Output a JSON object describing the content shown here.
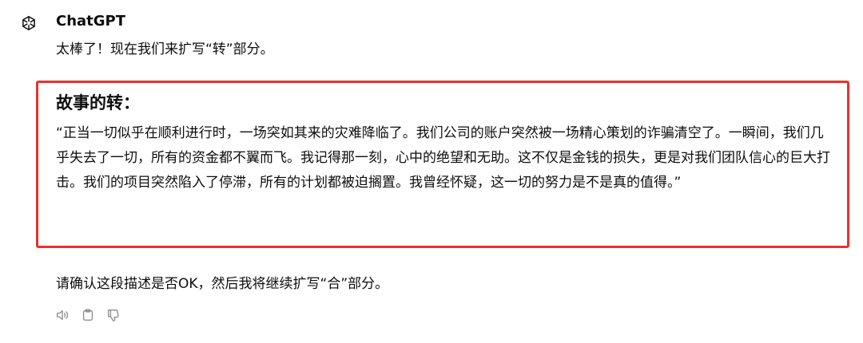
{
  "message": {
    "author": "ChatGPT",
    "intro": "太棒了！现在我们来扩写“转”部分。",
    "section_title": "故事的转：",
    "story": "“正当一切似乎在顺利进行时，一场突如其来的灾难降临了。我们公司的账户突然被一场精心策划的诈骗清空了。一瞬间，我们几乎失去了一切，所有的资金都不翼而飞。我记得那一刻，心中的绝望和无助。这不仅是金钱的损失，更是对我们团队信心的巨大打击。我们的项目突然陷入了停滞，所有的计划都被迫搁置。我曾经怀疑，这一切的努力是不是真的值得。”",
    "confirm": "请确认这段描述是否OK，然后我将继续扩写“合”部分。"
  },
  "colors": {
    "highlight_border": "#e8322b",
    "text": "#0d0d0d",
    "icon": "#8e8e8e"
  },
  "actions": [
    {
      "icon": "speaker-icon"
    },
    {
      "icon": "clipboard-icon"
    },
    {
      "icon": "thumbs-down-icon"
    }
  ]
}
